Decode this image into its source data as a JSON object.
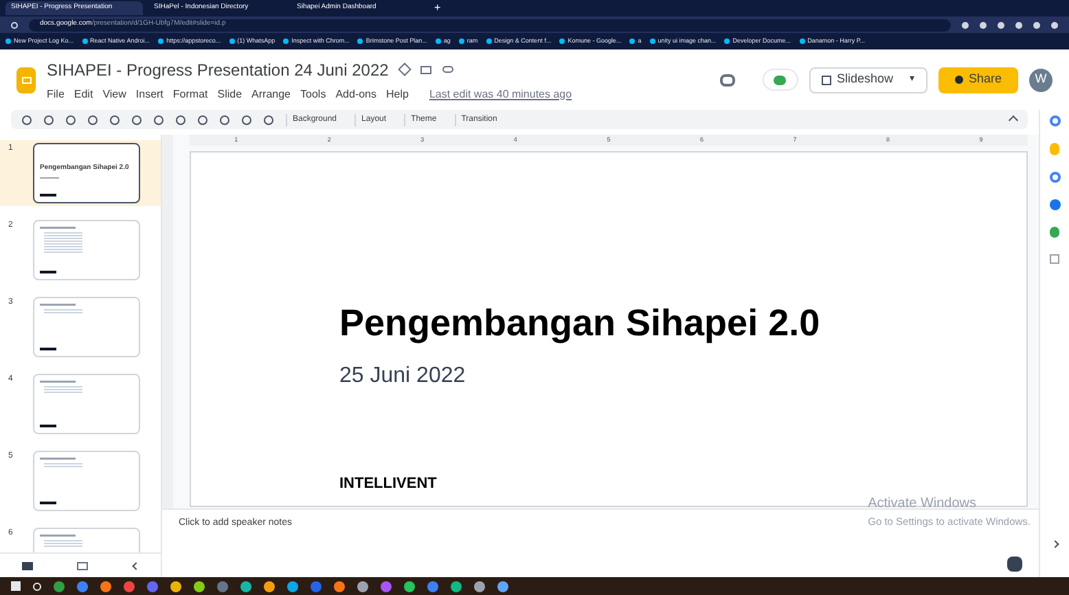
{
  "browser": {
    "tabs": [
      {
        "title": "SIHAPEI - Progress Presentation",
        "selected": true
      },
      {
        "title": "SIHaPel - Indonesian Directory",
        "selected": false
      },
      {
        "title": "Sihapei Admin Dashboard",
        "selected": false
      }
    ],
    "new_tab": "+",
    "url_host": "docs.google.com",
    "url_path": "/presentation/d/1GH-Ubfg7M/edit#slide=id.p",
    "bookmarks": [
      "New Project Log Ko...",
      "React Native Androi...",
      "https://appstoreco...",
      "(1) WhatsApp",
      "Inspect with Chrom...",
      "Brimstone Post Plan...",
      "ag",
      "ram",
      "Design & Content f...",
      "Komune - Google...",
      "a",
      "unity ui image chan...",
      "Developer Docume...",
      "Danamon - Harry P..."
    ]
  },
  "doc": {
    "title": "SIHAPEI - Progress Presentation 24 Juni 2022",
    "menu": [
      "File",
      "Edit",
      "View",
      "Insert",
      "Format",
      "Slide",
      "Arrange",
      "Tools",
      "Add-ons",
      "Help"
    ],
    "last_edit": "Last edit was 40 minutes ago",
    "slideshow": "Slideshow",
    "slideshow_menu": "▾",
    "share": "Share",
    "avatar": "W"
  },
  "toolbar": [
    "Background",
    "Layout",
    "Theme",
    "Transition"
  ],
  "ruler": [
    "1",
    "2",
    "3",
    "4",
    "5",
    "6",
    "7",
    "8",
    "9"
  ],
  "slides": [
    {
      "number": "1",
      "selected": true,
      "title": "Pengembangan Sihapei 2.0"
    },
    {
      "number": "2",
      "selected": false
    },
    {
      "number": "3",
      "selected": false
    },
    {
      "number": "4",
      "selected": false
    },
    {
      "number": "5",
      "selected": false
    },
    {
      "number": "6",
      "selected": false
    }
  ],
  "current_slide": {
    "title": "Pengembangan Sihapei 2.0",
    "subtitle": "25 Juni 2022",
    "brand": "INTELLIVENT"
  },
  "notes_placeholder": "Click to add speaker notes",
  "activation": {
    "title": "Activate Windows",
    "subtitle": "Go to Settings to activate Windows."
  }
}
